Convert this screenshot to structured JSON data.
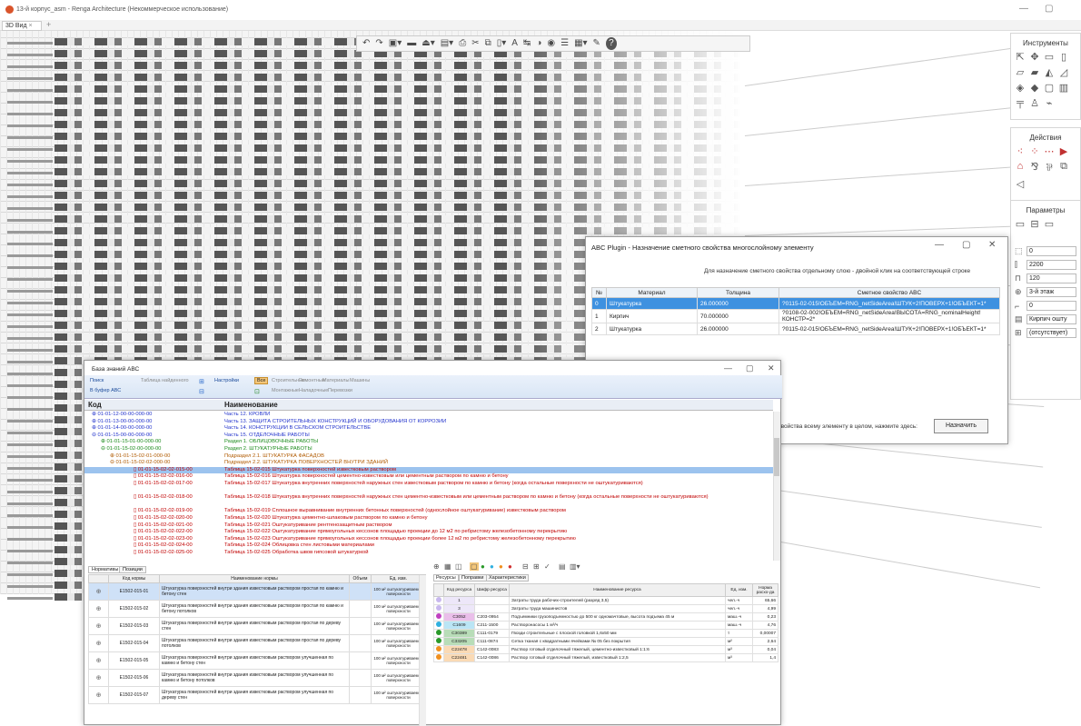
{
  "app": {
    "title": "13-й корпус_asm - Renga Architecture (Некоммерческое использование)",
    "tab": "3D Вид",
    "tab_close": "×",
    "tab_add": "+",
    "win_controls": [
      "—",
      "▢",
      "✕"
    ]
  },
  "toolbar": {
    "icons": [
      "undo-icon",
      "redo-icon",
      "view-icon",
      "grid-icon",
      "level-icon",
      "layer-icon",
      "print-icon",
      "cut-icon",
      "copy-icon",
      "paste-icon",
      "text-icon",
      "dimension-icon",
      "visibility-icon",
      "eye-icon",
      "list-icon",
      "table-icon",
      "wrench-icon",
      "help-icon"
    ]
  },
  "right_panel": {
    "tools_title": "Инструменты",
    "actions_title": "Действия",
    "params_title": "Параметры",
    "fields": [
      "0",
      "2200",
      "120",
      "3-й этаж",
      "0",
      "Кирпич ошту",
      "(отсутствует)"
    ]
  },
  "abc_dialog": {
    "title": "ABC Plugin - Назначение сметного свойства многослойному элементу",
    "hint": "Для назначение сметного свойства отдельному  слою - двойной клик на соответствующей строке",
    "columns": [
      "№",
      "Материал",
      "Толщина",
      "Сметное свойство ABC"
    ],
    "rows": [
      {
        "n": "0",
        "material": "Штукатурка",
        "thickness": "26.000000",
        "prop": "?0115-02-015!ОБЪЕМ=RNG_netSideArea!ШТУК+2!ПОВЕРХ+1!ОБЪЕКТ=1*"
      },
      {
        "n": "1",
        "material": "Кирпич",
        "thickness": "70.000000",
        "prop": "?0108-02-002!ОБЪЕМ=RNG_netSideArea!ВЫСОТА=RNG_nominalHeight!КОНСТР=2*"
      },
      {
        "n": "2",
        "material": "Штукатурка",
        "thickness": "26.000000",
        "prop": "?0115-02-015!ОБЪЕМ=RNG_netSideArea!ШТУК+2!ПОВЕРХ+1!ОБЪЕКТ=1*"
      }
    ],
    "bottom_text": "то свойства всему элементу в целом, нажмите здесь:",
    "assign_button": "Назначить"
  },
  "kb": {
    "title": "База знаний АВС",
    "toolbar": {
      "search": "Поиск",
      "buffer": "В буфер АВС",
      "found_table": "Таблица найденного",
      "settings": "Настройки",
      "all": "Все",
      "construction": "Строительные",
      "repair": "Ремонтные",
      "materials": "Материалы",
      "machines": "Машины",
      "mounting": "Монтажные",
      "adjustment": "Наладочные",
      "transport": "Перевозки"
    },
    "col_code": "Код",
    "col_name": "Наименование",
    "tree": [
      {
        "code": "⊕ 01-01-12-00-00-000-00",
        "name": "Часть 12. КРОВЛИ",
        "indent": 8,
        "color": "#2233cc"
      },
      {
        "code": "⊕ 01-01-13-00-00-000-00",
        "name": "Часть 13. ЗАЩИТА СТРОИТЕЛЬНЫХ КОНСТРУКЦИЙ И ОБОРУДОВАНИЯ ОТ КОРРОЗИИ",
        "indent": 8,
        "color": "#2233cc"
      },
      {
        "code": "⊕ 01-01-14-00-00-000-00",
        "name": "Часть 14. КОНСТРУКЦИИ В СЕЛЬСКОМ СТРОИТЕЛЬСТВЕ",
        "indent": 8,
        "color": "#2233cc"
      },
      {
        "code": "⊖ 01-01-15-00-00-000-00",
        "name": "Часть 15. ОТДЕЛОЧНЫЕ РАБОТЫ",
        "indent": 8,
        "color": "#2233cc"
      },
      {
        "code": "⊕ 01-01-15-01-00-000-00",
        "name": "Раздел 1. ОБЛИЦОВОЧНЫЕ РАБОТЫ",
        "indent": 18,
        "color": "#1a8a1a"
      },
      {
        "code": "⊖ 01-01-15-02-00-000-00",
        "name": "Раздел 2. ШТУКАТУРНЫЕ РАБОТЫ",
        "indent": 18,
        "color": "#1a8a1a"
      },
      {
        "code": "⊕ 01-01-15-02-01-000-00",
        "name": "Подраздел 2.1. ШТУКАТУРКА ФАСАДОВ",
        "indent": 28,
        "color": "#b05a00"
      },
      {
        "code": "⊖ 01-01-15-02-02-000-00",
        "name": "Подраздел 2.2. ШТУКАТУРКА ПОВЕРХНОСТЕЙ ВНУТРИ ЗДАНИЙ",
        "indent": 28,
        "color": "#b05a00"
      },
      {
        "code": "▯ 01-01-15-02-02-015-00",
        "name": "Таблица 15-02-015 Штукатурка поверхностей известковым раствором",
        "indent": 54,
        "color": "#c00000",
        "sel": true
      },
      {
        "code": "▯ 01-01-15-02-02-016-00",
        "name": "Таблица 15-02-016 Штукатурка поверхностей цементно-известковым или цементным раствором по камню и бетону",
        "indent": 54,
        "color": "#c00000"
      },
      {
        "code": "▯ 01-01-15-02-02-017-00",
        "name": "Таблица 15-02-017 Штукатурка внутренних поверхностей наружных стен известковым раствором по камню и бетону (когда остальные поверхности не оштукатуриваются)",
        "indent": 54,
        "color": "#c00000"
      },
      {
        "code": "",
        "name": "",
        "indent": 0,
        "color": "#c00000"
      },
      {
        "code": "▯ 01-01-15-02-02-018-00",
        "name": "Таблица 15-02-018 Штукатурка внутренних поверхностей наружных стен цементно-известковым или цементным раствором по камню и бетону (когда остальные поверхности не оштукатуриваются)",
        "indent": 54,
        "color": "#c00000"
      },
      {
        "code": "",
        "name": "",
        "indent": 0,
        "color": "#c00000"
      },
      {
        "code": "▯ 01-01-15-02-02-019-00",
        "name": "Таблица 15-02-019 Сплошное выравнивание внутренних бетонных поверхностей (однослойное оштукатуривание) известковым раствором",
        "indent": 54,
        "color": "#c00000"
      },
      {
        "code": "▯ 01-01-15-02-02-020-00",
        "name": "Таблица 15-02-020 Штукатурка цементно-шлаковым раствором по камню и бетону",
        "indent": 54,
        "color": "#c00000"
      },
      {
        "code": "▯ 01-01-15-02-02-021-00",
        "name": "Таблица 15-02-021 Оштукатуривание рентгенозащитным раствором",
        "indent": 54,
        "color": "#c00000"
      },
      {
        "code": "▯ 01-01-15-02-02-022-00",
        "name": "Таблица 15-02-022 Оштукатуривание прямоугольных кессонов площадью проекции до 12 м2 по ребристому железобетонному перекрытию",
        "indent": 54,
        "color": "#c00000"
      },
      {
        "code": "▯ 01-01-15-02-02-023-00",
        "name": "Таблица 15-02-023 Оштукатуривание прямоугольных кессонов площадью проекции более 12 м2 по ребристому железобетонному перекрытию",
        "indent": 54,
        "color": "#c00000"
      },
      {
        "code": "▯ 01-01-15-02-02-024-00",
        "name": "Таблица 15-02-024 Облицовка стен листовыми материалами",
        "indent": 54,
        "color": "#c00000"
      },
      {
        "code": "▯ 01-01-15-02-02-025-00",
        "name": "Таблица 15-02-025 Обработка швов гипсовой штукатуркой",
        "indent": 54,
        "color": "#c00000"
      }
    ],
    "norm_tabs": [
      "Нормативы",
      "Позиции"
    ],
    "norm_cols": [
      "Код нормы",
      "Наименование нормы",
      "Объем",
      "Ед. изм."
    ],
    "norms": [
      {
        "code": "Е1502-015-01",
        "name": "Штукатурка поверхностей внутри здания известковым раствором простая по камню и бетону стен",
        "vol": "",
        "unit": "100 м² оштукатуриваемой поверхности",
        "sel": true
      },
      {
        "code": "Е1502-015-02",
        "name": "Штукатурка поверхностей внутри здания известковым раствором простая по камню и бетону потолков",
        "vol": "",
        "unit": "100 м² оштукатуриваемой поверхности"
      },
      {
        "code": "Е1502-015-03",
        "name": "Штукатурка поверхностей внутри здания известковым раствором простая по дереву стен",
        "vol": "",
        "unit": "100 м² оштукатуриваемой поверхности"
      },
      {
        "code": "Е1502-015-04",
        "name": "Штукатурка поверхностей внутри здания известковым раствором простая по дереву потолков",
        "vol": "",
        "unit": "100 м² оштукатуриваемой поверхности"
      },
      {
        "code": "Е1502-015-05",
        "name": "Штукатурка поверхностей внутри здания известковым раствором улучшенная по камню и бетону стен",
        "vol": "",
        "unit": "100 м² оштукатуриваемой поверхности"
      },
      {
        "code": "Е1502-015-06",
        "name": "Штукатурка поверхностей внутри здания известковым раствором улучшенная по камню и бетону потолков",
        "vol": "",
        "unit": "100 м² оштукатуриваемой поверхности"
      },
      {
        "code": "Е1502-015-07",
        "name": "Штукатурка поверхностей внутри здания известковым раствором улучшенная по дереву стен",
        "vol": "",
        "unit": "100 м² оштукатуриваемой поверхности"
      }
    ],
    "res_tabs": [
      "Ресурсы",
      "Поправки",
      "Характеристики"
    ],
    "res_cols": [
      "Код ресурса",
      "Шифр ресурса",
      "Наименование ресурса",
      "Ед. изм.",
      "Норма расхо-да"
    ],
    "resources": [
      {
        "color": "#c8b8ee",
        "code": "1",
        "cipher": "",
        "name": "Затраты труда рабочих-строителей (разряд 3,5)",
        "unit": "чел.-ч",
        "norm": "65,66"
      },
      {
        "color": "#c8b8ee",
        "code": "3",
        "cipher": "",
        "name": "Затраты труда машинистов",
        "unit": "чел.-ч",
        "norm": "4,99"
      },
      {
        "color": "#c040c0",
        "code": "С3052",
        "cipher": "С203-0954",
        "name": "Подъемники грузоподъемностью до 500 кг одномачтовые, высота подъема 45 м",
        "unit": "маш.-ч",
        "norm": "0,23"
      },
      {
        "color": "#30b0e0",
        "code": "С1609",
        "cipher": "С211-1500",
        "name": "Растворонасосы 1 м³/ч",
        "unit": "маш.-ч",
        "norm": "4,76"
      },
      {
        "color": "#2a9a2a",
        "code": "С30389",
        "cipher": "С111-0179",
        "name": "Гвозди строительные с плоской головкой 1,6х50 мм",
        "unit": "т",
        "norm": "0,00007"
      },
      {
        "color": "#2a9a2a",
        "code": "С33205",
        "cipher": "С111-0874",
        "name": "Сетка тканая с квадратными ячейками № 05 без покрытия",
        "unit": "м²",
        "norm": "2,64"
      },
      {
        "color": "#f09020",
        "code": "С22478",
        "cipher": "С142-0083",
        "name": "Раствор готовый отделочный тяжелый, цементно-известковый 1:1:6",
        "unit": "м³",
        "norm": "0,04"
      },
      {
        "color": "#f09020",
        "code": "С22481",
        "cipher": "С142-0086",
        "name": "Раствор готовый отделочный тяжелый, известковый 1:2,5",
        "unit": "м³",
        "norm": "1,4"
      }
    ]
  }
}
